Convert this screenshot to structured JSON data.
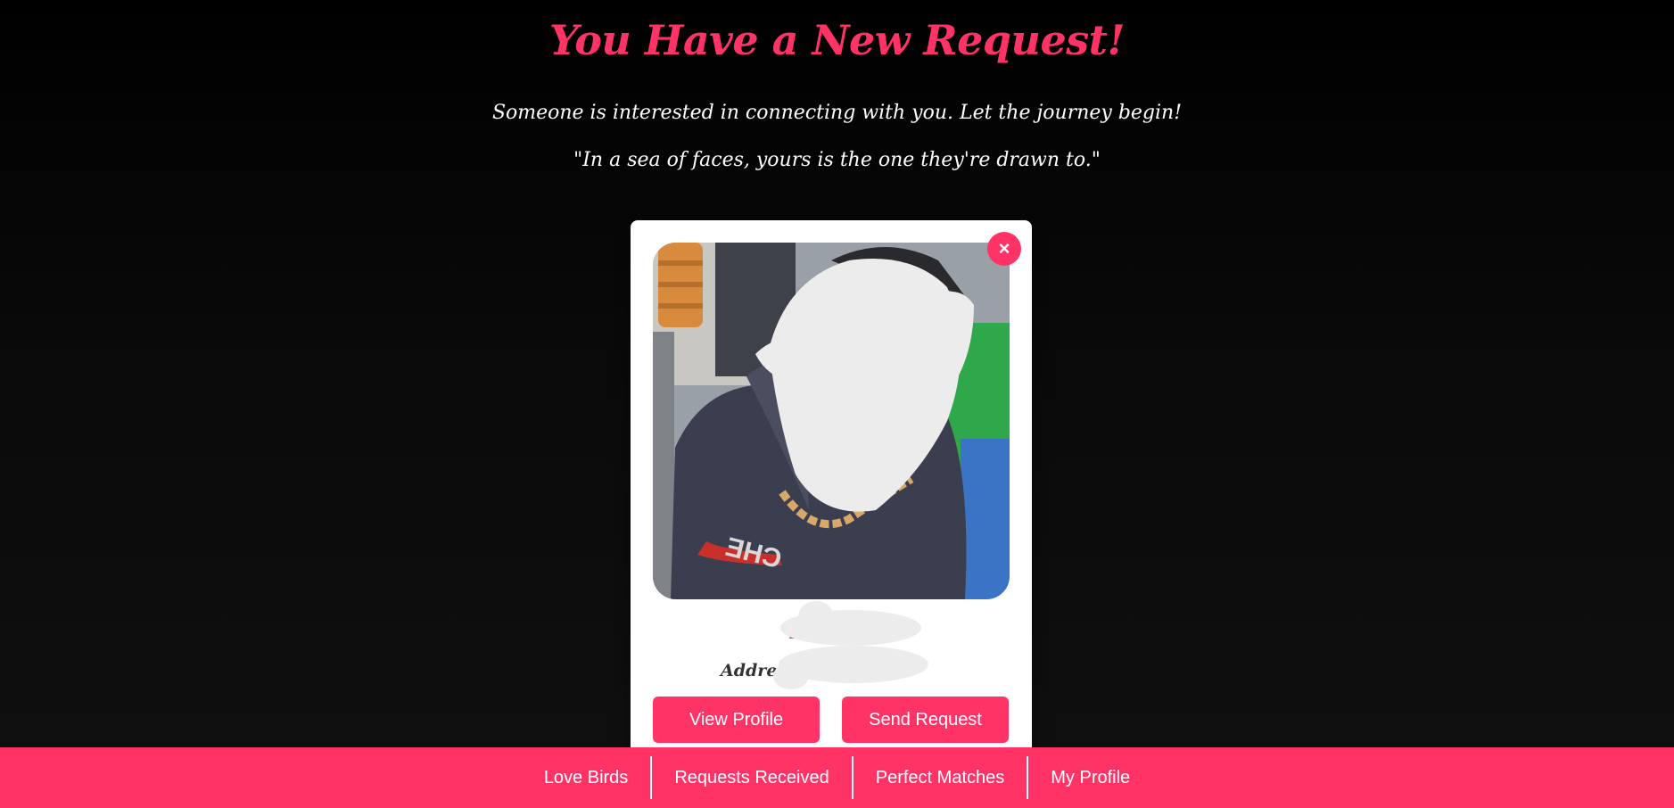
{
  "header": {
    "title": "You Have a New Request!",
    "subtitle": "Someone is interested in connecting with you. Let the journey begin!",
    "quote": "\"In a sea of faces, yours is the one they're drawn to.\""
  },
  "card": {
    "close_symbol": "×",
    "name": "Lucky",
    "address_label": "Address",
    "view_profile_label": "View Profile",
    "send_request_label": "Send Request"
  },
  "nav": {
    "items": [
      {
        "label": "Love Birds"
      },
      {
        "label": "Requests Received"
      },
      {
        "label": "Perfect Matches"
      },
      {
        "label": "My Profile"
      }
    ]
  },
  "colors": {
    "accent": "#ff3366",
    "background": "#000000",
    "card": "#ffffff",
    "redaction": "#ececec"
  }
}
